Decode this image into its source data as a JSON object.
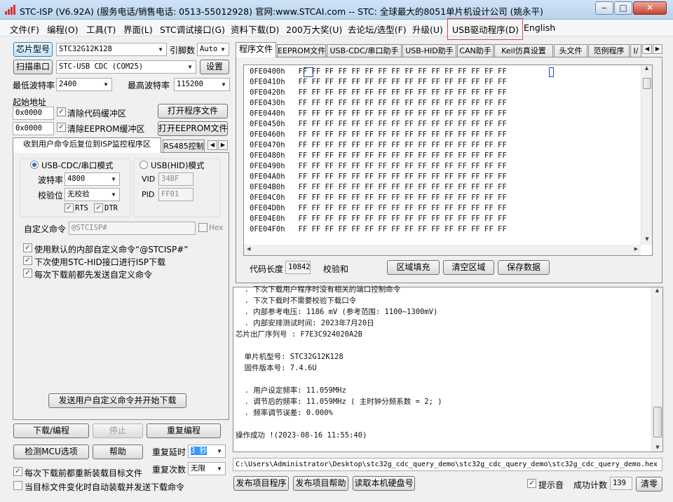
{
  "window": {
    "title": "STC-ISP (V6.92A) (服务电话/销售电话: 0513-55012928) 官网:www.STCAI.com  -- STC: 全球最大的8051单片机设计公司 (姚永平)",
    "min": "‒",
    "max": "□",
    "close": "✕"
  },
  "menu": [
    "文件(F)",
    "编程(O)",
    "工具(T)",
    "界面(L)",
    "STC调试接口(G)",
    "资料下载(D)",
    "200万大奖(U)",
    "去论坛/选型(F)",
    "升级(U)",
    "USB驱动程序(D)",
    "English"
  ],
  "left": {
    "chip_btn": "芯片型号",
    "chip_value": "STC32G12K128",
    "pins_label": "引脚数",
    "pins_value": "Auto",
    "scan_btn": "扫描串口",
    "port_value": "STC-USB CDC (COM25)",
    "settings_btn": "设置",
    "min_baud_label": "最低波特率",
    "min_baud_value": "2400",
    "max_baud_label": "最高波特率",
    "max_baud_value": "115200",
    "start_addr_label": "起始地址",
    "addr1": "0x0000",
    "clear_code": "清除代码缓冲区",
    "open_prog": "打开程序文件",
    "addr2": "0x0000",
    "clear_eeprom": "清除EEPROM缓冲区",
    "open_eeprom": "打开EEPROM文件",
    "tabs": [
      "收到用户命令后复位到ISP监控程序区",
      "RS485控制"
    ],
    "usb_cdc_mode": "USB-CDC/串口模式",
    "usb_hid_mode": "USB(HID)模式",
    "baud_label": "波特率",
    "baud_value": "4800",
    "vid_label": "VID",
    "vid_value": "34BF",
    "parity_label": "校验位",
    "parity_value": "无校验",
    "pid_label": "PID",
    "pid_value": "FF01",
    "rts": "RTS",
    "dtr": "DTR",
    "custom_cmd_label": "自定义命令",
    "custom_cmd_value": "@STCISP#",
    "hex_label": "Hex",
    "opt1": "使用默认的内部自定义命令“@STCISP#”",
    "opt2": "下次使用STC-HID接口进行ISP下载",
    "opt3": "每次下载前都先发送自定义命令",
    "send_btn": "发送用户自定义命令并开始下载",
    "download_btn": "下载/编程",
    "stop_btn": "停止",
    "reprogram_btn": "重复编程",
    "detect_btn": "检测MCU选项",
    "help_btn": "帮助",
    "repeat_delay_label": "重复延时",
    "repeat_delay_value": "3 秒",
    "repeat_count_label": "重复次数",
    "repeat_count_value": "无限",
    "reload_opt": "每次下载前都重新装载目标文件",
    "auto_opt": "当目标文件变化时自动装载并发送下载命令"
  },
  "right": {
    "tabs": [
      "程序文件",
      "EEPROM文件",
      "USB-CDC/串口助手",
      "USB-HID助手",
      "CAN助手",
      "Keil仿真设置",
      "头文件",
      "范例程序",
      "I/"
    ],
    "hex_rows": [
      {
        "addr": "0FE0400h",
        "data": "FF FF FF FF FF FF FF FF FF FF FF FF FF FF FF FF"
      },
      {
        "addr": "0FE0410h",
        "data": "FF FF FF FF FF FF FF FF FF FF FF FF FF FF FF FF"
      },
      {
        "addr": "0FE0420h",
        "data": "FF FF FF FF FF FF FF FF FF FF FF FF FF FF FF FF"
      },
      {
        "addr": "0FE0430h",
        "data": "FF FF FF FF FF FF FF FF FF FF FF FF FF FF FF FF"
      },
      {
        "addr": "0FE0440h",
        "data": "FF FF FF FF FF FF FF FF FF FF FF FF FF FF FF FF"
      },
      {
        "addr": "0FE0450h",
        "data": "FF FF FF FF FF FF FF FF FF FF FF FF FF FF FF FF"
      },
      {
        "addr": "0FE0460h",
        "data": "FF FF FF FF FF FF FF FF FF FF FF FF FF FF FF FF"
      },
      {
        "addr": "0FE0470h",
        "data": "FF FF FF FF FF FF FF FF FF FF FF FF FF FF FF FF"
      },
      {
        "addr": "0FE0480h",
        "data": "FF FF FF FF FF FF FF FF FF FF FF FF FF FF FF FF"
      },
      {
        "addr": "0FE0490h",
        "data": "FF FF FF FF FF FF FF FF FF FF FF FF FF FF FF FF"
      },
      {
        "addr": "0FE04A0h",
        "data": "FF FF FF FF FF FF FF FF FF FF FF FF FF FF FF FF"
      },
      {
        "addr": "0FE04B0h",
        "data": "FF FF FF FF FF FF FF FF FF FF FF FF FF FF FF FF"
      },
      {
        "addr": "0FE04C0h",
        "data": "FF FF FF FF FF FF FF FF FF FF FF FF FF FF FF FF"
      },
      {
        "addr": "0FE04D0h",
        "data": "FF FF FF FF FF FF FF FF FF FF FF FF FF FF FF FF"
      },
      {
        "addr": "0FE04E0h",
        "data": "FF FF FF FF FF FF FF FF FF FF FF FF FF FF FF FF"
      },
      {
        "addr": "0FE04F0h",
        "data": "FF FF FF FF FF FF FF FF FF FF FF FF FF FF FF FF"
      }
    ],
    "code_len_label": "代码长度",
    "code_len_value": "10842",
    "checksum_label": "校验和",
    "fill_btn": "区域填充",
    "clear_btn": "清空区域",
    "save_btn": "保存数据",
    "log_lines": [
      "  . 下次下载用户程序时没有相关的端口控制命令",
      "  . 下次下载时不需要校验下载口令",
      "  . 内部参考电压: 1186 mV (参考范围: 1100~1300mV)",
      "  . 内部安排测试时间: 2023年7月20日",
      "芯片出厂序列号 : F7E3C924020A2B",
      "",
      "  单片机型号: STC32G12K128",
      "  固件版本号: 7.4.6U",
      "",
      "  . 用户设定频率: 11.059MHz",
      "  . 调节后的频率: 11.059MHz ( 主时钟分频系数 = 2; )",
      "  . 频率调节误差: 0.000%",
      "",
      "操作成功 !(2023-08-16 11:55:40)"
    ],
    "file_path": "C:\\Users\\Administrator\\Desktop\\stc32g_cdc_query_demo\\stc32g_cdc_query_demo\\stc32g_cdc_query_demo.hex",
    "publish_prog": "发布项目程序",
    "publish_help": "发布项目帮助",
    "read_disk": "读取本机硬盘号",
    "sound_label": "提示音",
    "success_label": "成功计数",
    "success_value": "139",
    "clear_count": "清零"
  }
}
